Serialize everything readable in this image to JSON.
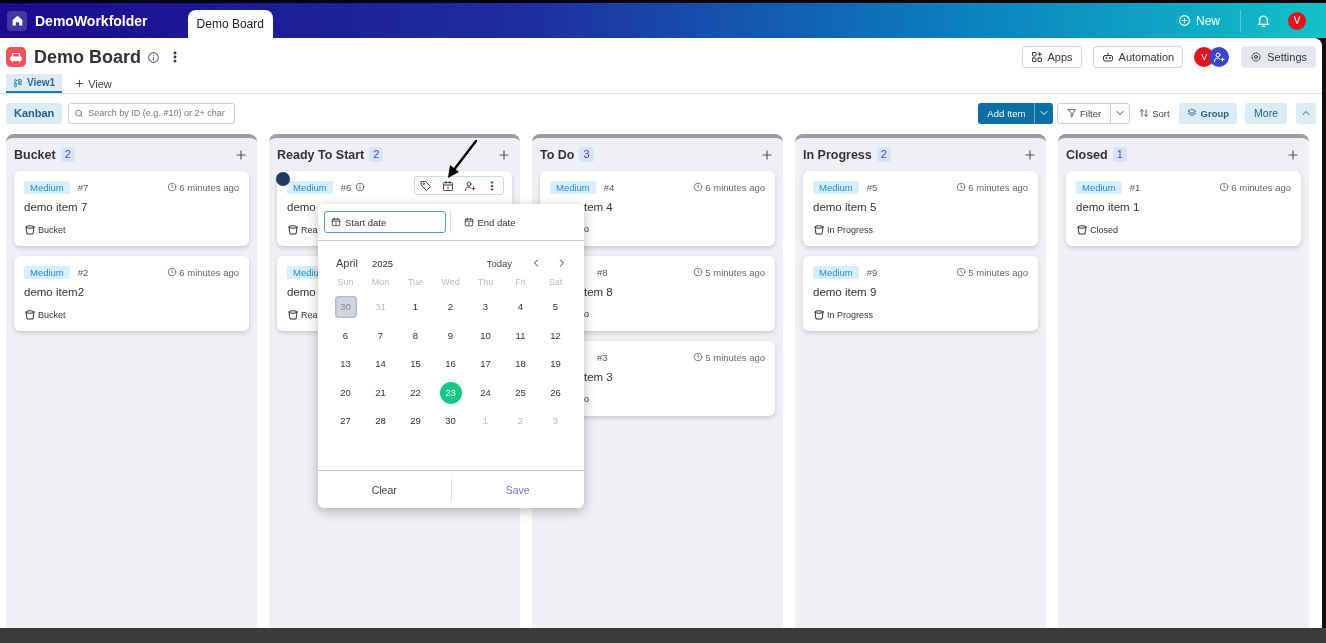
{
  "top_bar": {
    "workspace": "DemoWorkfolder",
    "tab": "Demo Board",
    "new_button": "New",
    "avatar": "V"
  },
  "board": {
    "title": "Demo Board",
    "buttons": [
      "Apps",
      "Automation"
    ],
    "member": "V",
    "settings": "Settings"
  },
  "views": [
    {
      "label": "View1",
      "selected": true
    }
  ],
  "add_view": "View",
  "toolbar": {
    "layout": "Kanban",
    "search_placeholder": "Search by ID (e.g. #10) or 2+ char",
    "add_item": "Add Item",
    "filter": "Filter",
    "sort": "Sort",
    "group": "Group",
    "more": "More"
  },
  "columns": [
    {
      "name": "Bucket",
      "count": "2",
      "cards": [
        {
          "tag": "Medium",
          "id": "#7",
          "time": "6 minutes ago",
          "title": "demo item 7",
          "status": "Bucket"
        },
        {
          "tag": "Medium",
          "id": "#2",
          "time": "6 minutes ago",
          "title": "demo item2",
          "status": "Bucket"
        }
      ]
    },
    {
      "name": "Ready To Start",
      "count": "2",
      "cards": [
        {
          "tag": "Medium",
          "id": "#6",
          "info": true,
          "hovered": true,
          "title": "demo",
          "status": "Rea"
        },
        {
          "tag": "Mediu",
          "title": "demo",
          "status": "Rea"
        }
      ]
    },
    {
      "name": "To Do",
      "count": "3",
      "cards": [
        {
          "tag": "Medium",
          "id": "#4",
          "time": "6 minutes ago",
          "title": "tem 4",
          "status": "o",
          "hidden_left": true
        },
        {
          "id": "#8",
          "time": "5 minutes ago",
          "title": "tem 8",
          "status": "o",
          "hidden_left": true
        },
        {
          "id": "#3",
          "time": "5 minutes ago",
          "title": "tem 3",
          "status": "o",
          "hidden_left": true
        }
      ]
    },
    {
      "name": "In Progress",
      "count": "2",
      "cards": [
        {
          "tag": "Medium",
          "id": "#5",
          "time": "6 minutes ago",
          "title": "demo item 5",
          "status": "In Progress"
        },
        {
          "tag": "Medium",
          "id": "#9",
          "time": "5 minutes ago",
          "title": "demo item 9",
          "status": "In Progress"
        }
      ]
    },
    {
      "name": "Closed",
      "count": "1",
      "cards": [
        {
          "tag": "Medium",
          "id": "#1",
          "time": "6 minutes ago",
          "title": "demo item 1",
          "status": "Closed"
        }
      ]
    }
  ],
  "date_picker": {
    "fields": [
      {
        "placeholder": "Start date",
        "focused": true
      },
      {
        "placeholder": "End date",
        "focused": false
      }
    ],
    "month": "April",
    "year": "2025",
    "today": "Today",
    "weekdays": [
      "Sun",
      "Mon",
      "Tue",
      "Wed",
      "Thu",
      "Fri",
      "Sat"
    ],
    "days": [
      {
        "label": "30",
        "muted": true,
        "selected": true,
        "today": false
      },
      {
        "label": "31",
        "muted": true,
        "selected": false,
        "today": false
      },
      {
        "label": "1",
        "muted": false,
        "selected": false,
        "today": false
      },
      {
        "label": "2",
        "muted": false,
        "selected": false,
        "today": false
      },
      {
        "label": "3",
        "muted": false,
        "selected": false,
        "today": false
      },
      {
        "label": "4",
        "muted": false,
        "selected": false,
        "today": false
      },
      {
        "label": "5",
        "muted": false,
        "selected": false,
        "today": false
      },
      {
        "label": "6",
        "muted": false,
        "selected": false,
        "today": false
      },
      {
        "label": "7",
        "muted": false,
        "selected": false,
        "today": false
      },
      {
        "label": "8",
        "muted": false,
        "selected": false,
        "today": false
      },
      {
        "label": "9",
        "muted": false,
        "selected": false,
        "today": false
      },
      {
        "label": "10",
        "muted": false,
        "selected": false,
        "today": false
      },
      {
        "label": "11",
        "muted": false,
        "selected": false,
        "today": false
      },
      {
        "label": "12",
        "muted": false,
        "selected": false,
        "today": false
      },
      {
        "label": "13",
        "muted": false,
        "selected": false,
        "today": false
      },
      {
        "label": "14",
        "muted": false,
        "selected": false,
        "today": false
      },
      {
        "label": "15",
        "muted": false,
        "selected": false,
        "today": false
      },
      {
        "label": "16",
        "muted": false,
        "selected": false,
        "today": false
      },
      {
        "label": "17",
        "muted": false,
        "selected": false,
        "today": false
      },
      {
        "label": "18",
        "muted": false,
        "selected": false,
        "today": false
      },
      {
        "label": "19",
        "muted": false,
        "selected": false,
        "today": false
      },
      {
        "label": "20",
        "muted": false,
        "selected": false,
        "today": false
      },
      {
        "label": "21",
        "muted": false,
        "selected": false,
        "today": false
      },
      {
        "label": "22",
        "muted": false,
        "selected": false,
        "today": false
      },
      {
        "label": "23",
        "muted": false,
        "selected": false,
        "today": true
      },
      {
        "label": "24",
        "muted": false,
        "selected": false,
        "today": false
      },
      {
        "label": "25",
        "muted": false,
        "selected": false,
        "today": false
      },
      {
        "label": "26",
        "muted": false,
        "selected": false,
        "today": false
      },
      {
        "label": "27",
        "muted": false,
        "selected": false,
        "today": false
      },
      {
        "label": "28",
        "muted": false,
        "selected": false,
        "today": false
      },
      {
        "label": "29",
        "muted": false,
        "selected": false,
        "today": false
      },
      {
        "label": "30",
        "muted": false,
        "selected": false,
        "today": false
      },
      {
        "label": "1",
        "muted": true,
        "selected": false,
        "today": false
      },
      {
        "label": "2",
        "muted": true,
        "selected": false,
        "today": false
      },
      {
        "label": "3",
        "muted": true,
        "selected": false,
        "today": false
      }
    ],
    "clear": "Clear",
    "save": "Save"
  }
}
